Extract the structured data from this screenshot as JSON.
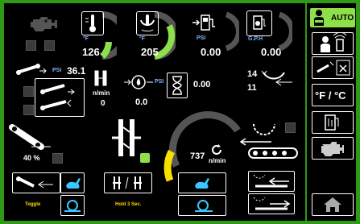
{
  "gauges": {
    "coolant": {
      "value": "126",
      "unit": "°F",
      "level": 0.3
    },
    "oil_temp": {
      "value": "205",
      "unit": "°F",
      "level": 0.6
    },
    "fuel_pressure": {
      "value": "0.00",
      "unit": "PSI"
    },
    "fuel_flow": {
      "value": "0.00",
      "unit": "G.P.H"
    }
  },
  "conveyor": {
    "pressure_value": "36.1",
    "pressure_unit": "PSI",
    "speed_unit": "n/min",
    "speed_value": "0",
    "angle_label": "40 %"
  },
  "center": {
    "pump_value": "0.0",
    "pump_unit": "PSI",
    "hours_value": "0.00"
  },
  "right_counts": {
    "top": "14",
    "bottom": "11"
  },
  "rotor": {
    "value": "737",
    "unit": "n/min",
    "level": 0.25
  },
  "bottom_labels": {
    "toggle": "Toggle",
    "hold": "Hold 3 Sec."
  },
  "sidebar": {
    "auto_label": "AUTO",
    "temp_unit_label": "°F / °C"
  },
  "colors": {
    "accent_green": "#8ee04a",
    "warning_yellow": "#f5e000",
    "frame_green": "#2f9a16",
    "text_blue": "#7fb3ff"
  },
  "icons": [
    "engine-check-icon",
    "thermometer-icon",
    "oil-temp-icon",
    "fuel-pump-icon",
    "fuel-flow-icon",
    "conveyor-icon",
    "valve-icon",
    "pump-icon",
    "hourglass-icon",
    "rotation-icon",
    "crusher-icon",
    "rabbit-icon",
    "snail-icon",
    "operator-icon",
    "remote-icon",
    "belt-icon",
    "thermo-unit-icon",
    "engine-icon",
    "home-icon"
  ]
}
